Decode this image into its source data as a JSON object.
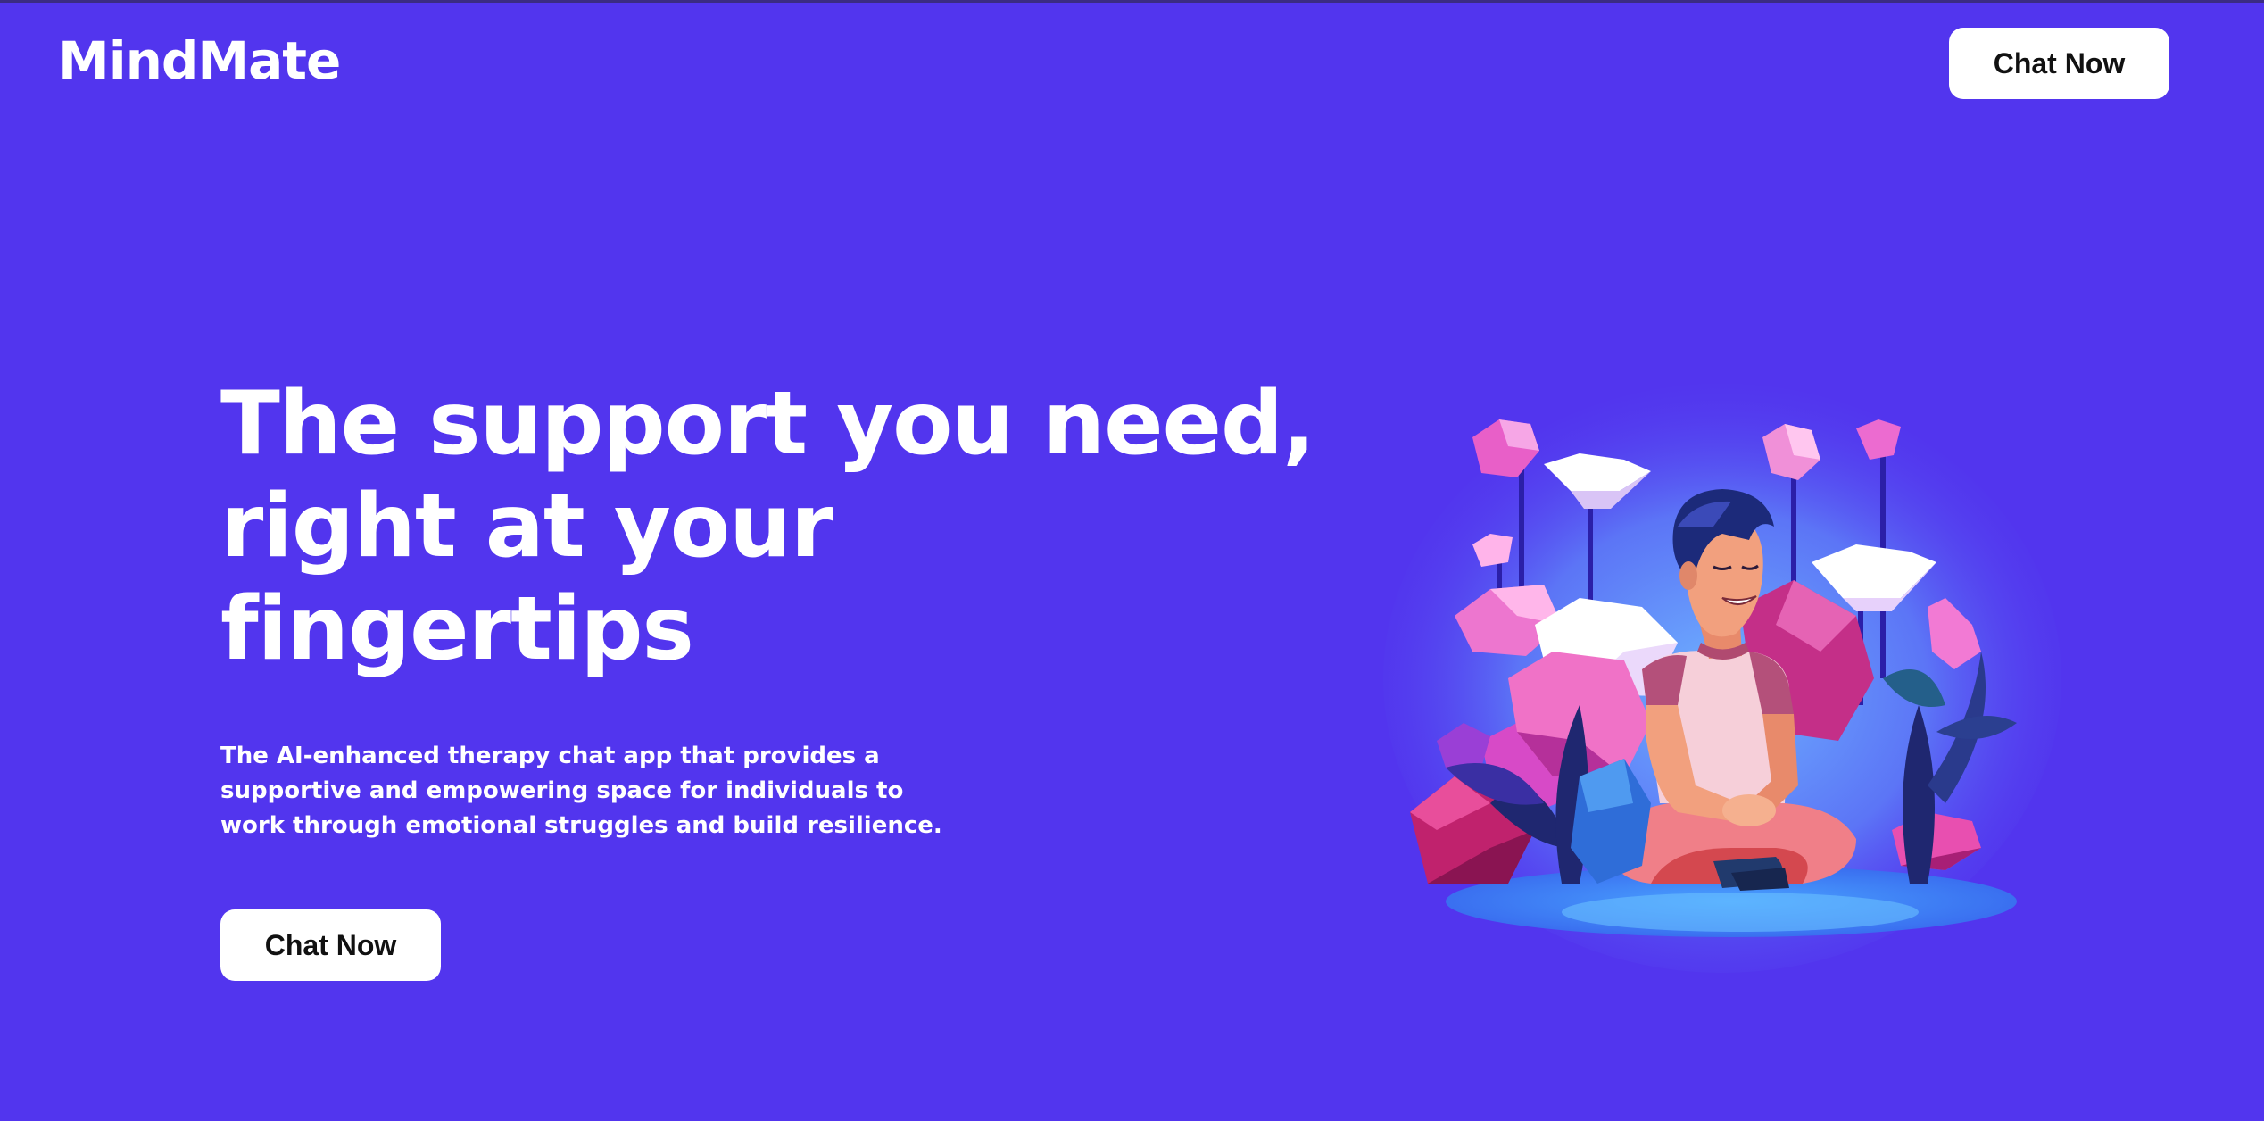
{
  "header": {
    "logo": "MindMate",
    "cta_label": "Chat Now"
  },
  "hero": {
    "headline_lines": [
      "The support you need,",
      "right at your",
      "fingertips"
    ],
    "description": "The AI-enhanced therapy chat app that provides a supportive and empowering space for individuals to work through emotional struggles and build resilience.",
    "cta_label": "Chat Now"
  },
  "colors": {
    "background": "#5235ee",
    "button_bg": "#ffffff",
    "button_text": "#111111",
    "text": "#ffffff"
  }
}
